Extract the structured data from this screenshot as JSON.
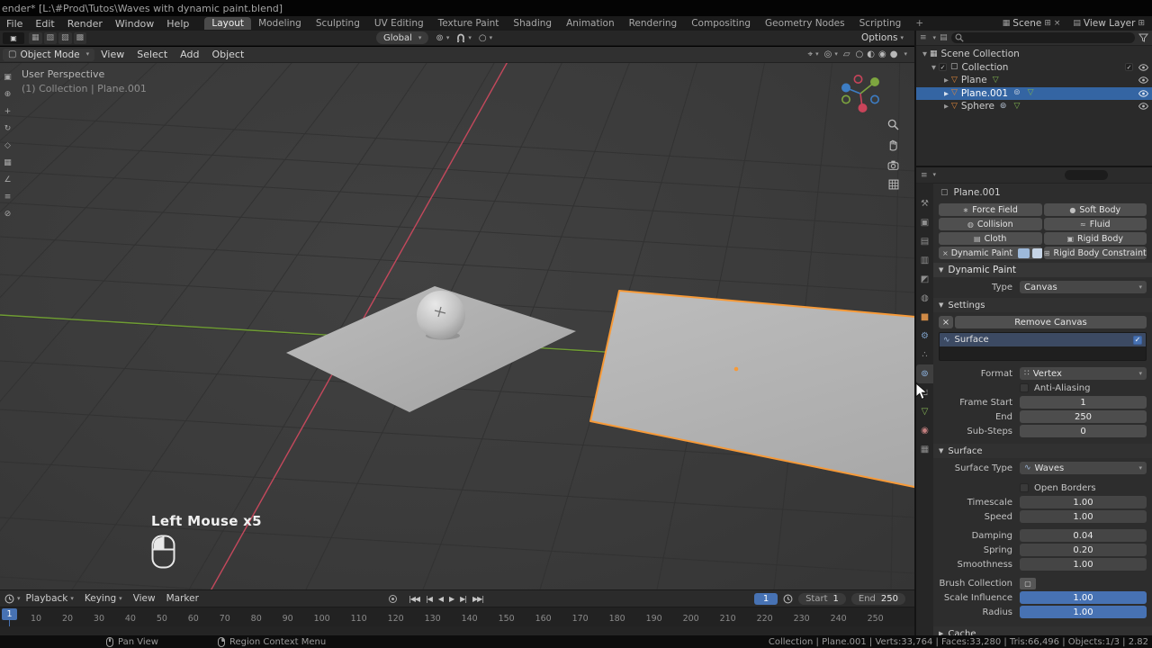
{
  "window": {
    "title": "ender* [L:\\#Prod\\Tutos\\Waves with dynamic paint.blend]"
  },
  "menubar": {
    "menus": [
      "File",
      "Edit",
      "Render",
      "Window",
      "Help"
    ],
    "workspaces": [
      "Layout",
      "Modeling",
      "Sculpting",
      "UV Editing",
      "Texture Paint",
      "Shading",
      "Animation",
      "Rendering",
      "Compositing",
      "Geometry Nodes",
      "Scripting"
    ],
    "add_workspace": "+",
    "scene_label": "Scene",
    "view_layer_label": "View Layer"
  },
  "toolbar": {
    "select_modes": [
      "▦",
      "▧",
      "▨",
      "▩"
    ],
    "orientation": "Global",
    "options": "Options"
  },
  "viewport": {
    "mode": "Object Mode",
    "menus": [
      "View",
      "Select",
      "Add",
      "Object"
    ],
    "header_icons": [
      "⌖",
      "◎",
      "▱"
    ],
    "shading": [
      "○",
      "◐",
      "◉",
      "●"
    ],
    "tools": [
      "▣",
      "⊕",
      "+",
      "↻",
      "◇",
      "▦",
      "∠",
      "≡",
      "⊘"
    ],
    "overlay_line1": "User Perspective",
    "overlay_line2": "(1) Collection | Plane.001",
    "screencast_label": "Left Mouse x5"
  },
  "timeline": {
    "menus": [
      "Playback",
      "Keying",
      "View",
      "Marker"
    ],
    "transport": [
      "|◀◀",
      "|◀",
      "◀",
      "▶",
      "▶|",
      "▶▶|"
    ],
    "current_frame": "1",
    "playhead": "1",
    "start_label": "Start",
    "start_value": "1",
    "end_label": "End",
    "end_value": "250",
    "ruler": [
      "10",
      "20",
      "30",
      "40",
      "50",
      "60",
      "70",
      "80",
      "90",
      "100",
      "110",
      "120",
      "130",
      "140",
      "150",
      "160",
      "170",
      "180",
      "190",
      "200",
      "210",
      "220",
      "230",
      "240",
      "250"
    ]
  },
  "statusbar": {
    "hint_pan": "Pan View",
    "hint_context": "Region Context Menu",
    "stats": "Collection | Plane.001 | Verts:33,764 | Faces:33,280 | Tris:66,496 | Objects:1/3 | 2.82"
  },
  "outliner": {
    "rows": {
      "scene_collection": "Scene Collection",
      "collection": "Collection",
      "plane": "Plane",
      "plane001": "Plane.001",
      "sphere": "Sphere"
    }
  },
  "properties": {
    "tab_icons": [
      "⚒",
      "▣",
      "▤",
      "▥",
      "◩",
      "◍",
      "■",
      "⚙",
      "∴",
      "⊚",
      "⊔",
      "▽",
      "◉",
      "▦"
    ],
    "breadcrumb": "Plane.001",
    "buttons": {
      "force_field": "Force Field",
      "soft_body": "Soft Body",
      "collision": "Collision",
      "fluid": "Fluid",
      "cloth": "Cloth",
      "rigid_body": "Rigid Body",
      "dynamic_paint": "Dynamic Paint",
      "rigid_body_constraint": "Rigid Body Constraint"
    },
    "dynamic_paint": {
      "title": "Dynamic Paint",
      "type_label": "Type",
      "type_value": "Canvas"
    },
    "settings": {
      "title": "Settings",
      "remove_canvas": "Remove Canvas",
      "surface_item": "Surface",
      "format_label": "Format",
      "format_value": "Vertex",
      "antialiasing_label": "Anti-Aliasing",
      "frame_start_label": "Frame Start",
      "frame_start_value": "1",
      "end_label": "End",
      "end_value": "250",
      "substeps_label": "Sub-Steps",
      "substeps_value": "0"
    },
    "surface": {
      "title": "Surface",
      "type_label": "Surface Type",
      "type_value": "Waves",
      "open_borders_label": "Open Borders",
      "timescale_label": "Timescale",
      "timescale_value": "1.00",
      "speed_label": "Speed",
      "speed_value": "1.00",
      "damping_label": "Damping",
      "damping_value": "0.04",
      "spring_label": "Spring",
      "spring_value": "0.20",
      "smoothness_label": "Smoothness",
      "smoothness_value": "1.00",
      "brush_collection_label": "Brush Collection",
      "scale_influence_label": "Scale Influence",
      "scale_influence_value": "1.00",
      "radius_label": "Radius",
      "radius_value": "1.00"
    },
    "cache": {
      "title": "Cache"
    }
  },
  "icons": {
    "caret": "▾",
    "tri_down": "▼",
    "tri_right": "▶",
    "mesh": "▽",
    "collection": "▢",
    "scene_collection": "▦",
    "physics": "⊚",
    "data": "▽",
    "waves": "∿",
    "vertex": "∷",
    "check": "✓",
    "close": "×",
    "new": "⊞",
    "view_layer": "▤",
    "editor_menu": "≡",
    "object": "▢"
  },
  "colors": {
    "accent_blue": "#4772b3",
    "selection_orange": "#f79a38",
    "row_selection": "#3465a3"
  }
}
